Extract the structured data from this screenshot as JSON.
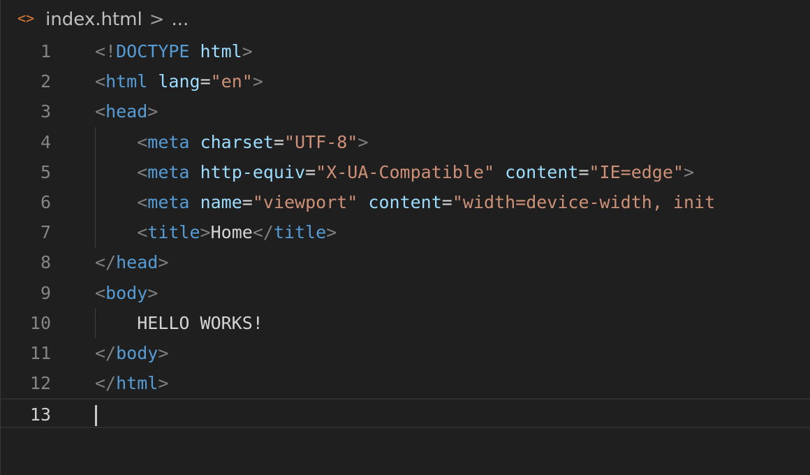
{
  "breadcrumb": {
    "icon": "code-brackets-icon",
    "icon_glyph": "<>",
    "file": "index.html",
    "separator": ">",
    "ellipsis": "..."
  },
  "colors": {
    "background": "#1f1f1f",
    "punctuation": "#808080",
    "tag": "#569cd6",
    "attribute": "#9cdcfe",
    "string": "#ce9178",
    "text": "#d4d4d4",
    "file_icon": "#e37933"
  },
  "editor": {
    "current_line": 13,
    "lines": [
      {
        "num": "1",
        "tokens": [
          {
            "c": "p",
            "t": "<!"
          },
          {
            "c": "t",
            "t": "DOCTYPE"
          },
          {
            "c": "x",
            "t": " "
          },
          {
            "c": "a",
            "t": "html"
          },
          {
            "c": "p",
            "t": ">"
          }
        ]
      },
      {
        "num": "2",
        "tokens": [
          {
            "c": "p",
            "t": "<"
          },
          {
            "c": "t",
            "t": "html"
          },
          {
            "c": "x",
            "t": " "
          },
          {
            "c": "a",
            "t": "lang"
          },
          {
            "c": "x",
            "t": "="
          },
          {
            "c": "s",
            "t": "\"en\""
          },
          {
            "c": "p",
            "t": ">"
          }
        ]
      },
      {
        "num": "3",
        "tokens": [
          {
            "c": "p",
            "t": "<"
          },
          {
            "c": "t",
            "t": "head"
          },
          {
            "c": "p",
            "t": ">"
          }
        ]
      },
      {
        "num": "4",
        "tokens": [
          {
            "c": "x",
            "t": "    "
          },
          {
            "c": "p",
            "t": "<"
          },
          {
            "c": "t",
            "t": "meta"
          },
          {
            "c": "x",
            "t": " "
          },
          {
            "c": "a",
            "t": "charset"
          },
          {
            "c": "x",
            "t": "="
          },
          {
            "c": "s",
            "t": "\"UTF-8\""
          },
          {
            "c": "p",
            "t": ">"
          }
        ]
      },
      {
        "num": "5",
        "tokens": [
          {
            "c": "x",
            "t": "    "
          },
          {
            "c": "p",
            "t": "<"
          },
          {
            "c": "t",
            "t": "meta"
          },
          {
            "c": "x",
            "t": " "
          },
          {
            "c": "a",
            "t": "http-equiv"
          },
          {
            "c": "x",
            "t": "="
          },
          {
            "c": "s",
            "t": "\"X-UA-Compatible\""
          },
          {
            "c": "x",
            "t": " "
          },
          {
            "c": "a",
            "t": "content"
          },
          {
            "c": "x",
            "t": "="
          },
          {
            "c": "s",
            "t": "\"IE=edge\""
          },
          {
            "c": "p",
            "t": ">"
          }
        ]
      },
      {
        "num": "6",
        "tokens": [
          {
            "c": "x",
            "t": "    "
          },
          {
            "c": "p",
            "t": "<"
          },
          {
            "c": "t",
            "t": "meta"
          },
          {
            "c": "x",
            "t": " "
          },
          {
            "c": "a",
            "t": "name"
          },
          {
            "c": "x",
            "t": "="
          },
          {
            "c": "s",
            "t": "\"viewport\""
          },
          {
            "c": "x",
            "t": " "
          },
          {
            "c": "a",
            "t": "content"
          },
          {
            "c": "x",
            "t": "="
          },
          {
            "c": "s",
            "t": "\"width=device-width, init"
          }
        ]
      },
      {
        "num": "7",
        "tokens": [
          {
            "c": "x",
            "t": "    "
          },
          {
            "c": "p",
            "t": "<"
          },
          {
            "c": "t",
            "t": "title"
          },
          {
            "c": "p",
            "t": ">"
          },
          {
            "c": "x",
            "t": "Home"
          },
          {
            "c": "p",
            "t": "</"
          },
          {
            "c": "t",
            "t": "title"
          },
          {
            "c": "p",
            "t": ">"
          }
        ]
      },
      {
        "num": "8",
        "tokens": [
          {
            "c": "p",
            "t": "</"
          },
          {
            "c": "t",
            "t": "head"
          },
          {
            "c": "p",
            "t": ">"
          }
        ]
      },
      {
        "num": "9",
        "tokens": [
          {
            "c": "p",
            "t": "<"
          },
          {
            "c": "t",
            "t": "body"
          },
          {
            "c": "p",
            "t": ">"
          }
        ]
      },
      {
        "num": "10",
        "tokens": [
          {
            "c": "x",
            "t": "    HELLO WORKS!"
          }
        ]
      },
      {
        "num": "11",
        "tokens": [
          {
            "c": "p",
            "t": "</"
          },
          {
            "c": "t",
            "t": "body"
          },
          {
            "c": "p",
            "t": ">"
          }
        ]
      },
      {
        "num": "12",
        "tokens": [
          {
            "c": "p",
            "t": "</"
          },
          {
            "c": "t",
            "t": "html"
          },
          {
            "c": "p",
            "t": ">"
          }
        ]
      },
      {
        "num": "13",
        "tokens": []
      }
    ]
  }
}
